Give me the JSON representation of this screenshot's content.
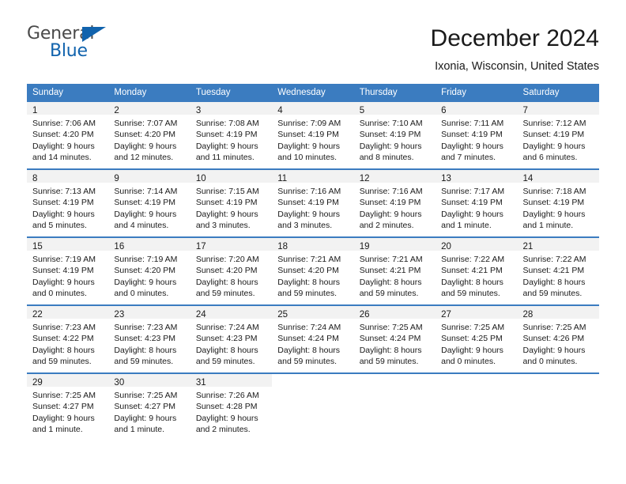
{
  "logo": {
    "word_one": "General",
    "word_two": "Blue",
    "triangle_icon": "triangle-icon",
    "accent_color": "#1163ad"
  },
  "header": {
    "title": "December 2024",
    "subtitle": "Ixonia, Wisconsin, United States"
  },
  "calendar": {
    "header_color": "#3b7cc0",
    "daynum_band_color": "#f2f2f2",
    "weekday_headers": [
      "Sunday",
      "Monday",
      "Tuesday",
      "Wednesday",
      "Thursday",
      "Friday",
      "Saturday"
    ],
    "weeks": [
      [
        {
          "day": "1",
          "sunrise": "Sunrise: 7:06 AM",
          "sunset": "Sunset: 4:20 PM",
          "daylight_1": "Daylight: 9 hours",
          "daylight_2": "and 14 minutes."
        },
        {
          "day": "2",
          "sunrise": "Sunrise: 7:07 AM",
          "sunset": "Sunset: 4:20 PM",
          "daylight_1": "Daylight: 9 hours",
          "daylight_2": "and 12 minutes."
        },
        {
          "day": "3",
          "sunrise": "Sunrise: 7:08 AM",
          "sunset": "Sunset: 4:19 PM",
          "daylight_1": "Daylight: 9 hours",
          "daylight_2": "and 11 minutes."
        },
        {
          "day": "4",
          "sunrise": "Sunrise: 7:09 AM",
          "sunset": "Sunset: 4:19 PM",
          "daylight_1": "Daylight: 9 hours",
          "daylight_2": "and 10 minutes."
        },
        {
          "day": "5",
          "sunrise": "Sunrise: 7:10 AM",
          "sunset": "Sunset: 4:19 PM",
          "daylight_1": "Daylight: 9 hours",
          "daylight_2": "and 8 minutes."
        },
        {
          "day": "6",
          "sunrise": "Sunrise: 7:11 AM",
          "sunset": "Sunset: 4:19 PM",
          "daylight_1": "Daylight: 9 hours",
          "daylight_2": "and 7 minutes."
        },
        {
          "day": "7",
          "sunrise": "Sunrise: 7:12 AM",
          "sunset": "Sunset: 4:19 PM",
          "daylight_1": "Daylight: 9 hours",
          "daylight_2": "and 6 minutes."
        }
      ],
      [
        {
          "day": "8",
          "sunrise": "Sunrise: 7:13 AM",
          "sunset": "Sunset: 4:19 PM",
          "daylight_1": "Daylight: 9 hours",
          "daylight_2": "and 5 minutes."
        },
        {
          "day": "9",
          "sunrise": "Sunrise: 7:14 AM",
          "sunset": "Sunset: 4:19 PM",
          "daylight_1": "Daylight: 9 hours",
          "daylight_2": "and 4 minutes."
        },
        {
          "day": "10",
          "sunrise": "Sunrise: 7:15 AM",
          "sunset": "Sunset: 4:19 PM",
          "daylight_1": "Daylight: 9 hours",
          "daylight_2": "and 3 minutes."
        },
        {
          "day": "11",
          "sunrise": "Sunrise: 7:16 AM",
          "sunset": "Sunset: 4:19 PM",
          "daylight_1": "Daylight: 9 hours",
          "daylight_2": "and 3 minutes."
        },
        {
          "day": "12",
          "sunrise": "Sunrise: 7:16 AM",
          "sunset": "Sunset: 4:19 PM",
          "daylight_1": "Daylight: 9 hours",
          "daylight_2": "and 2 minutes."
        },
        {
          "day": "13",
          "sunrise": "Sunrise: 7:17 AM",
          "sunset": "Sunset: 4:19 PM",
          "daylight_1": "Daylight: 9 hours",
          "daylight_2": "and 1 minute."
        },
        {
          "day": "14",
          "sunrise": "Sunrise: 7:18 AM",
          "sunset": "Sunset: 4:19 PM",
          "daylight_1": "Daylight: 9 hours",
          "daylight_2": "and 1 minute."
        }
      ],
      [
        {
          "day": "15",
          "sunrise": "Sunrise: 7:19 AM",
          "sunset": "Sunset: 4:19 PM",
          "daylight_1": "Daylight: 9 hours",
          "daylight_2": "and 0 minutes."
        },
        {
          "day": "16",
          "sunrise": "Sunrise: 7:19 AM",
          "sunset": "Sunset: 4:20 PM",
          "daylight_1": "Daylight: 9 hours",
          "daylight_2": "and 0 minutes."
        },
        {
          "day": "17",
          "sunrise": "Sunrise: 7:20 AM",
          "sunset": "Sunset: 4:20 PM",
          "daylight_1": "Daylight: 8 hours",
          "daylight_2": "and 59 minutes."
        },
        {
          "day": "18",
          "sunrise": "Sunrise: 7:21 AM",
          "sunset": "Sunset: 4:20 PM",
          "daylight_1": "Daylight: 8 hours",
          "daylight_2": "and 59 minutes."
        },
        {
          "day": "19",
          "sunrise": "Sunrise: 7:21 AM",
          "sunset": "Sunset: 4:21 PM",
          "daylight_1": "Daylight: 8 hours",
          "daylight_2": "and 59 minutes."
        },
        {
          "day": "20",
          "sunrise": "Sunrise: 7:22 AM",
          "sunset": "Sunset: 4:21 PM",
          "daylight_1": "Daylight: 8 hours",
          "daylight_2": "and 59 minutes."
        },
        {
          "day": "21",
          "sunrise": "Sunrise: 7:22 AM",
          "sunset": "Sunset: 4:21 PM",
          "daylight_1": "Daylight: 8 hours",
          "daylight_2": "and 59 minutes."
        }
      ],
      [
        {
          "day": "22",
          "sunrise": "Sunrise: 7:23 AM",
          "sunset": "Sunset: 4:22 PM",
          "daylight_1": "Daylight: 8 hours",
          "daylight_2": "and 59 minutes."
        },
        {
          "day": "23",
          "sunrise": "Sunrise: 7:23 AM",
          "sunset": "Sunset: 4:23 PM",
          "daylight_1": "Daylight: 8 hours",
          "daylight_2": "and 59 minutes."
        },
        {
          "day": "24",
          "sunrise": "Sunrise: 7:24 AM",
          "sunset": "Sunset: 4:23 PM",
          "daylight_1": "Daylight: 8 hours",
          "daylight_2": "and 59 minutes."
        },
        {
          "day": "25",
          "sunrise": "Sunrise: 7:24 AM",
          "sunset": "Sunset: 4:24 PM",
          "daylight_1": "Daylight: 8 hours",
          "daylight_2": "and 59 minutes."
        },
        {
          "day": "26",
          "sunrise": "Sunrise: 7:25 AM",
          "sunset": "Sunset: 4:24 PM",
          "daylight_1": "Daylight: 8 hours",
          "daylight_2": "and 59 minutes."
        },
        {
          "day": "27",
          "sunrise": "Sunrise: 7:25 AM",
          "sunset": "Sunset: 4:25 PM",
          "daylight_1": "Daylight: 9 hours",
          "daylight_2": "and 0 minutes."
        },
        {
          "day": "28",
          "sunrise": "Sunrise: 7:25 AM",
          "sunset": "Sunset: 4:26 PM",
          "daylight_1": "Daylight: 9 hours",
          "daylight_2": "and 0 minutes."
        }
      ],
      [
        {
          "day": "29",
          "sunrise": "Sunrise: 7:25 AM",
          "sunset": "Sunset: 4:27 PM",
          "daylight_1": "Daylight: 9 hours",
          "daylight_2": "and 1 minute."
        },
        {
          "day": "30",
          "sunrise": "Sunrise: 7:25 AM",
          "sunset": "Sunset: 4:27 PM",
          "daylight_1": "Daylight: 9 hours",
          "daylight_2": "and 1 minute."
        },
        {
          "day": "31",
          "sunrise": "Sunrise: 7:26 AM",
          "sunset": "Sunset: 4:28 PM",
          "daylight_1": "Daylight: 9 hours",
          "daylight_2": "and 2 minutes."
        },
        {
          "day": "",
          "sunrise": "",
          "sunset": "",
          "daylight_1": "",
          "daylight_2": ""
        },
        {
          "day": "",
          "sunrise": "",
          "sunset": "",
          "daylight_1": "",
          "daylight_2": ""
        },
        {
          "day": "",
          "sunrise": "",
          "sunset": "",
          "daylight_1": "",
          "daylight_2": ""
        },
        {
          "day": "",
          "sunrise": "",
          "sunset": "",
          "daylight_1": "",
          "daylight_2": ""
        }
      ]
    ]
  }
}
